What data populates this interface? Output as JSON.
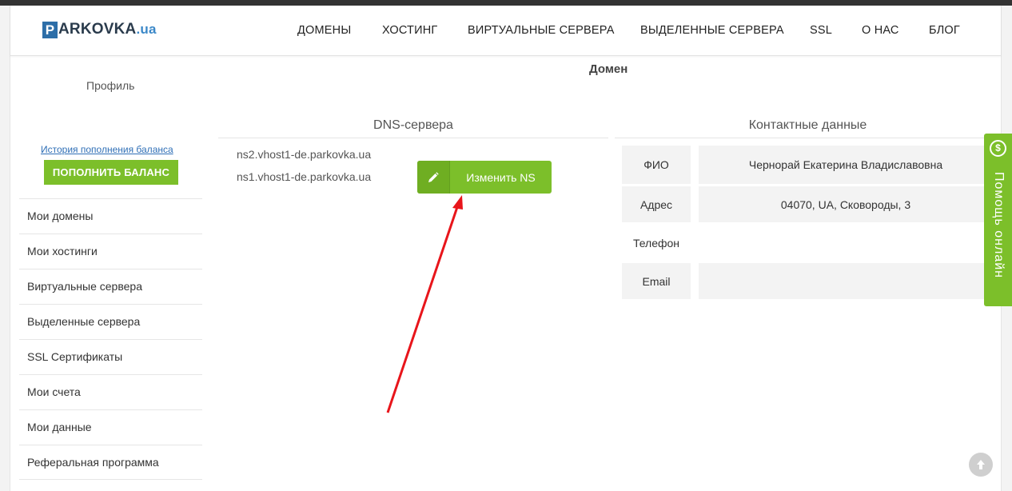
{
  "header": {
    "logo": {
      "p": "P",
      "text": "ARKOVKA",
      "suffix": ".ua"
    },
    "nav": [
      "ДОМЕНЫ",
      "ХОСТИНГ",
      "ВИРТУАЛЬНЫЕ СЕРВЕРА",
      "ВЫДЕЛЕННЫЕ СЕРВЕРА",
      "SSL",
      "О НАС",
      "БЛОГ"
    ]
  },
  "page_title": "Домен",
  "sidebar": {
    "profile": "Профиль",
    "history_link": "История пополнения баланса",
    "topup_button": "ПОПОЛНИТЬ БАЛАНС",
    "items": [
      "Мои домены",
      "Мои хостинги",
      "Виртуальные сервера",
      "Выделенные сервера",
      "SSL Сертификаты",
      "Мои счета",
      "Мои данные",
      "Реферальная программа"
    ]
  },
  "dns": {
    "title": "DNS-сервера",
    "servers": [
      "ns2.vhost1-de.parkovka.ua",
      "ns1.vhost1-de.parkovka.ua"
    ],
    "change_button": "Изменить NS",
    "icon": "pencil-icon"
  },
  "contacts": {
    "title": "Контактные данные",
    "rows": [
      {
        "label": "ФИО",
        "value": "Чернорай Екатерина Владиславовна"
      },
      {
        "label": "Адрес",
        "value": "04070, UA, Сковороды, 3"
      },
      {
        "label": "Телефон",
        "value": ""
      },
      {
        "label": "Email",
        "value": ""
      }
    ]
  },
  "help_tab": {
    "label": "Помощь онлайн",
    "icon": "dollar-icon"
  },
  "colors": {
    "accent": "#7cbf2a",
    "link": "#2f6fb6",
    "arrow": "#e8151b"
  }
}
